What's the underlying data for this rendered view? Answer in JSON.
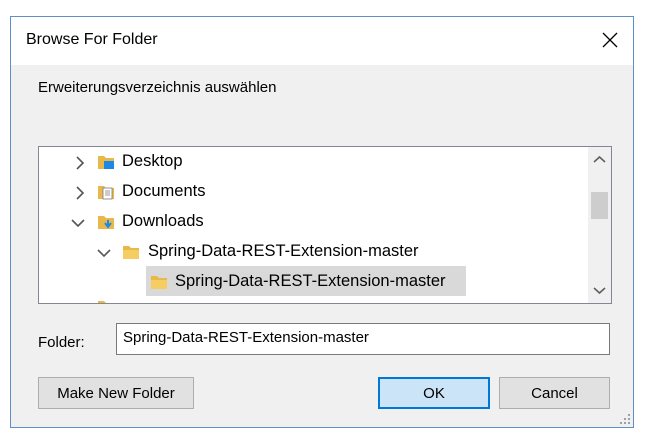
{
  "dialog": {
    "title": "Browse For Folder",
    "instruction": "Erweiterungsverzeichnis auswählen",
    "tree": {
      "items": [
        {
          "label": "Desktop",
          "expanded": false
        },
        {
          "label": "Documents",
          "expanded": false
        },
        {
          "label": "Downloads",
          "expanded": true
        },
        {
          "label": "Spring-Data-REST-Extension-master",
          "expanded": true
        },
        {
          "label": "Spring-Data-REST-Extension-master",
          "selected": true
        }
      ]
    },
    "folder_label": "Folder:",
    "folder_value": "Spring-Data-REST-Extension-master",
    "buttons": {
      "make_new_folder": "Make New Folder",
      "ok": "OK",
      "cancel": "Cancel"
    }
  },
  "colors": {
    "border": "#5e8fc7",
    "selected": "#d9d9d9",
    "ok_border": "#0078d7",
    "folder": "#e8b94a"
  }
}
